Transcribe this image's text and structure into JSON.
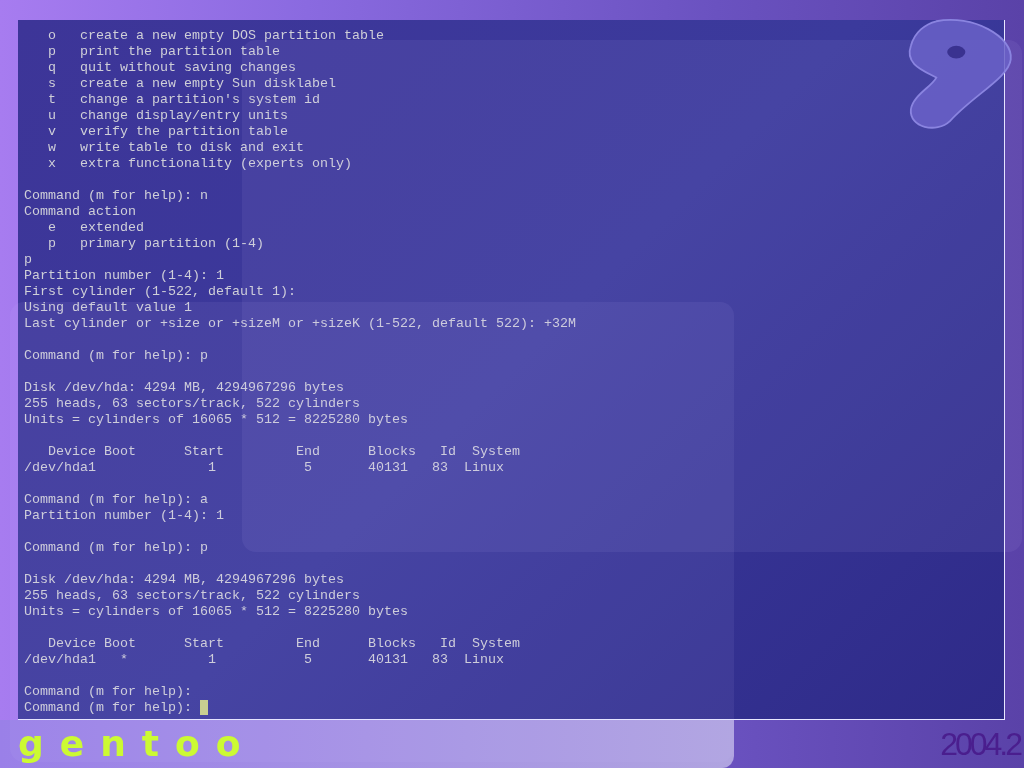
{
  "terminal": {
    "blocks": [
      [
        "   o   create a new empty DOS partition table",
        "   p   print the partition table",
        "   q   quit without saving changes",
        "   s   create a new empty Sun disklabel",
        "   t   change a partition's system id",
        "   u   change display/entry units",
        "   v   verify the partition table",
        "   w   write table to disk and exit",
        "   x   extra functionality (experts only)"
      ],
      [
        "Command (m for help): n",
        "Command action",
        "   e   extended",
        "   p   primary partition (1-4)",
        "p",
        "Partition number (1-4): 1",
        "First cylinder (1-522, default 1):",
        "Using default value 1",
        "Last cylinder or +size or +sizeM or +sizeK (1-522, default 522): +32M"
      ],
      [
        "Command (m for help): p"
      ],
      [
        "Disk /dev/hda: 4294 MB, 4294967296 bytes",
        "255 heads, 63 sectors/track, 522 cylinders",
        "Units = cylinders of 16065 * 512 = 8225280 bytes"
      ],
      [
        "   Device Boot      Start         End      Blocks   Id  System",
        "/dev/hda1              1           5       40131   83  Linux"
      ],
      [
        "Command (m for help): a",
        "Partition number (1-4): 1"
      ],
      [
        "Command (m for help): p"
      ],
      [
        "Disk /dev/hda: 4294 MB, 4294967296 bytes",
        "255 heads, 63 sectors/track, 522 cylinders",
        "Units = cylinders of 16065 * 512 = 8225280 bytes"
      ],
      [
        "   Device Boot      Start         End      Blocks   Id  System",
        "/dev/hda1   *          1           5       40131   83  Linux"
      ],
      [
        "Command (m for help):",
        "Command (m for help): "
      ]
    ],
    "cursor": true
  },
  "branding": {
    "logo_text": "gentoo",
    "version": "2004.2"
  }
}
